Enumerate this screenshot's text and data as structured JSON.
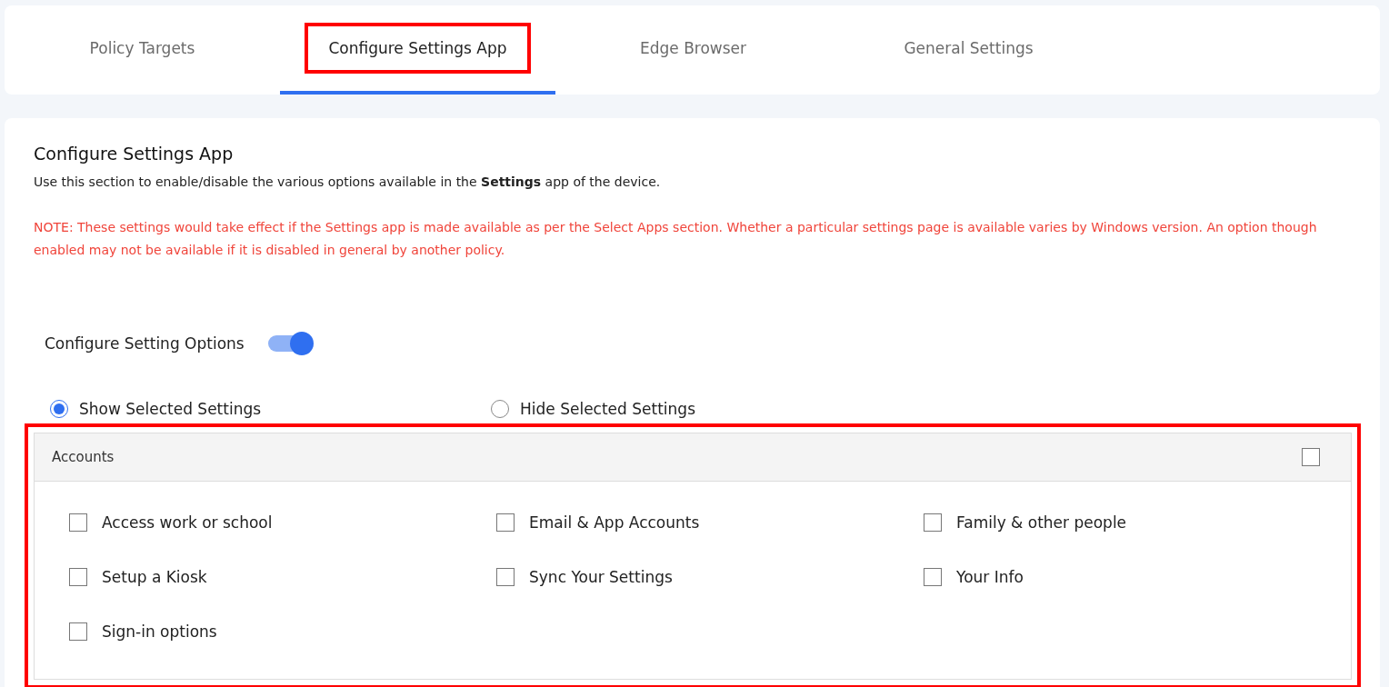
{
  "tabs": [
    {
      "label": "Policy Targets",
      "selected": false,
      "highlighted": false
    },
    {
      "label": "Configure Settings App",
      "selected": true,
      "highlighted": true
    },
    {
      "label": "Edge Browser",
      "selected": false,
      "highlighted": false
    },
    {
      "label": "General Settings",
      "selected": false,
      "highlighted": false
    }
  ],
  "section": {
    "title": "Configure Settings App",
    "description": "Use this section to enable/disable the various options available in the **Settings** app of the device.",
    "note": "NOTE: These settings would take effect if the Settings app is made available as per the Select Apps section. Whether a particular settings page is available varies by Windows version. An option though enabled may not be available if it is disabled in general by another policy."
  },
  "toggle": {
    "label": "Configure Setting Options",
    "on": true
  },
  "modes": [
    {
      "label": "Show Selected Settings",
      "selected": true
    },
    {
      "label": "Hide Selected Settings",
      "selected": false
    }
  ],
  "group": {
    "title": "Accounts",
    "checked": false,
    "highlighted": true,
    "items": [
      {
        "label": "Access work or school",
        "checked": false
      },
      {
        "label": "Email & App Accounts",
        "checked": false
      },
      {
        "label": "Family & other people",
        "checked": false
      },
      {
        "label": "Setup a Kiosk",
        "checked": false
      },
      {
        "label": "Sync Your Settings",
        "checked": false
      },
      {
        "label": "Your Info",
        "checked": false
      },
      {
        "label": "Sign-in options",
        "checked": false
      }
    ]
  }
}
